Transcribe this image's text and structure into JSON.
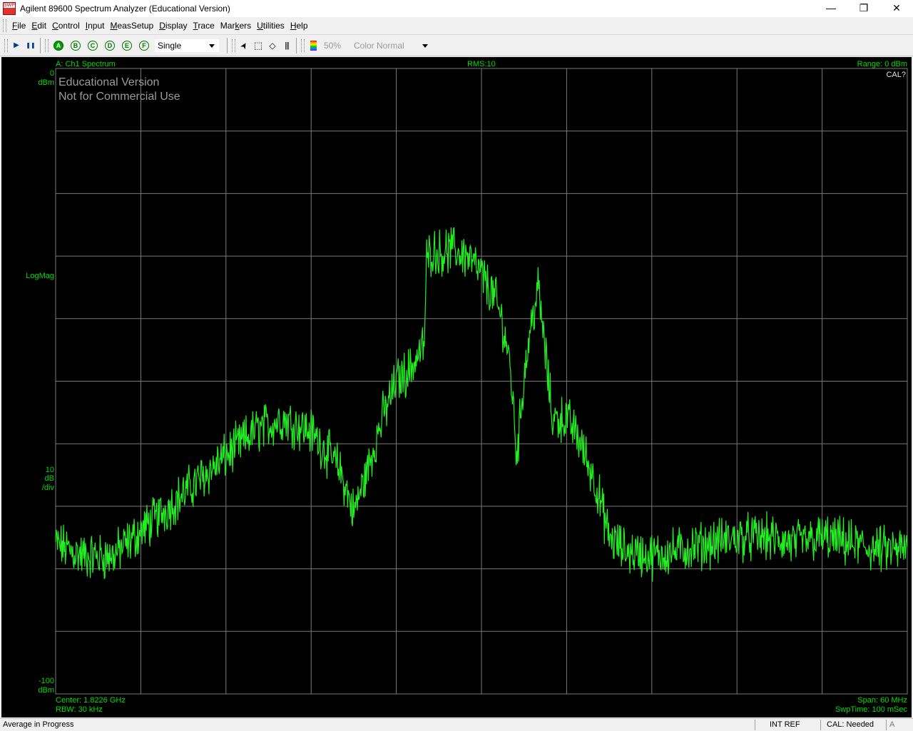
{
  "window": {
    "title": "Agilent 89600 Spectrum Analyzer (Educational Version)",
    "icon_text": "SWP",
    "minimize": "—",
    "restore": "❐",
    "close": "✕"
  },
  "menu": [
    {
      "pre": "",
      "ul": "F",
      "post": "ile"
    },
    {
      "pre": "",
      "ul": "E",
      "post": "dit"
    },
    {
      "pre": "",
      "ul": "C",
      "post": "ontrol"
    },
    {
      "pre": "",
      "ul": "I",
      "post": "nput"
    },
    {
      "pre": "",
      "ul": "M",
      "post": "easSetup"
    },
    {
      "pre": "",
      "ul": "D",
      "post": "isplay"
    },
    {
      "pre": "",
      "ul": "T",
      "post": "race"
    },
    {
      "pre": "Mar",
      "ul": "k",
      "post": "ers"
    },
    {
      "pre": "",
      "ul": "U",
      "post": "tilities"
    },
    {
      "pre": "",
      "ul": "H",
      "post": "elp"
    }
  ],
  "toolbar": {
    "play": "▶",
    "pause": "❚❚",
    "traces": [
      "A",
      "B",
      "C",
      "D",
      "E",
      "F"
    ],
    "mode": "Single",
    "pointer": "➤",
    "zoom_box": "⬚",
    "marker": "◇",
    "bars": "|||",
    "persistence": "50%",
    "color_mode": "Color Normal"
  },
  "trace": {
    "name": "A: Ch1 Spectrum",
    "averaging": "RMS:10",
    "range": "Range: 0 dBm",
    "cal": "CAL?",
    "y_top": "0",
    "y_top_unit": "dBm",
    "y_format": "LogMag",
    "y_scale_value": "10",
    "y_scale_unit1": "dB",
    "y_scale_unit2": "/div",
    "y_bottom": "-100",
    "y_bottom_unit": "dBm",
    "center": "Center: 1.8226 GHz",
    "rbw": "RBW: 30 kHz",
    "span": "Span: 60 MHz",
    "sweep_time": "SwpTime: 100 mSec",
    "trace_color": "#22ee22",
    "grid_color": "#7a7a7a"
  },
  "watermark": {
    "line1": "Educational Version",
    "line2": "Not for Commercial Use"
  },
  "chart_data": {
    "type": "line",
    "xlabel": "",
    "ylabel": "",
    "x_range_mhz": [
      -30,
      30
    ],
    "ylim": [
      -100,
      0
    ],
    "grid": true,
    "x_divisions": 10,
    "y_divisions": 10,
    "x_mhz": [
      -30,
      -28,
      -26,
      -24,
      -22,
      -20,
      -18,
      -16,
      -14,
      -12,
      -10,
      -9,
      -8,
      -7,
      -6,
      -5,
      -4,
      -3.9,
      -3.5,
      -3,
      -2,
      -1,
      0,
      1,
      1.5,
      2,
      2.5,
      3,
      3.5,
      4,
      5,
      6,
      6.6,
      7,
      8,
      9,
      10,
      12,
      14,
      16,
      18,
      20,
      22,
      24,
      26,
      28,
      30
    ],
    "y_dbm": [
      -76,
      -78,
      -78,
      -74,
      -70,
      -66,
      -62,
      -58,
      -56,
      -58,
      -64,
      -71,
      -64,
      -56,
      -50,
      -48,
      -44,
      -31,
      -29,
      -29.5,
      -29,
      -30,
      -33,
      -37,
      -41,
      -47,
      -62,
      -49,
      -41,
      -35,
      -56,
      -56,
      -58,
      -60,
      -66,
      -75,
      -77,
      -78,
      -77,
      -76,
      -75,
      -75,
      -76,
      -75,
      -76,
      -77,
      -77
    ]
  },
  "status": {
    "message": "Average in Progress",
    "ref": "INT REF",
    "cal": "CAL: Needed",
    "trace": "A"
  }
}
